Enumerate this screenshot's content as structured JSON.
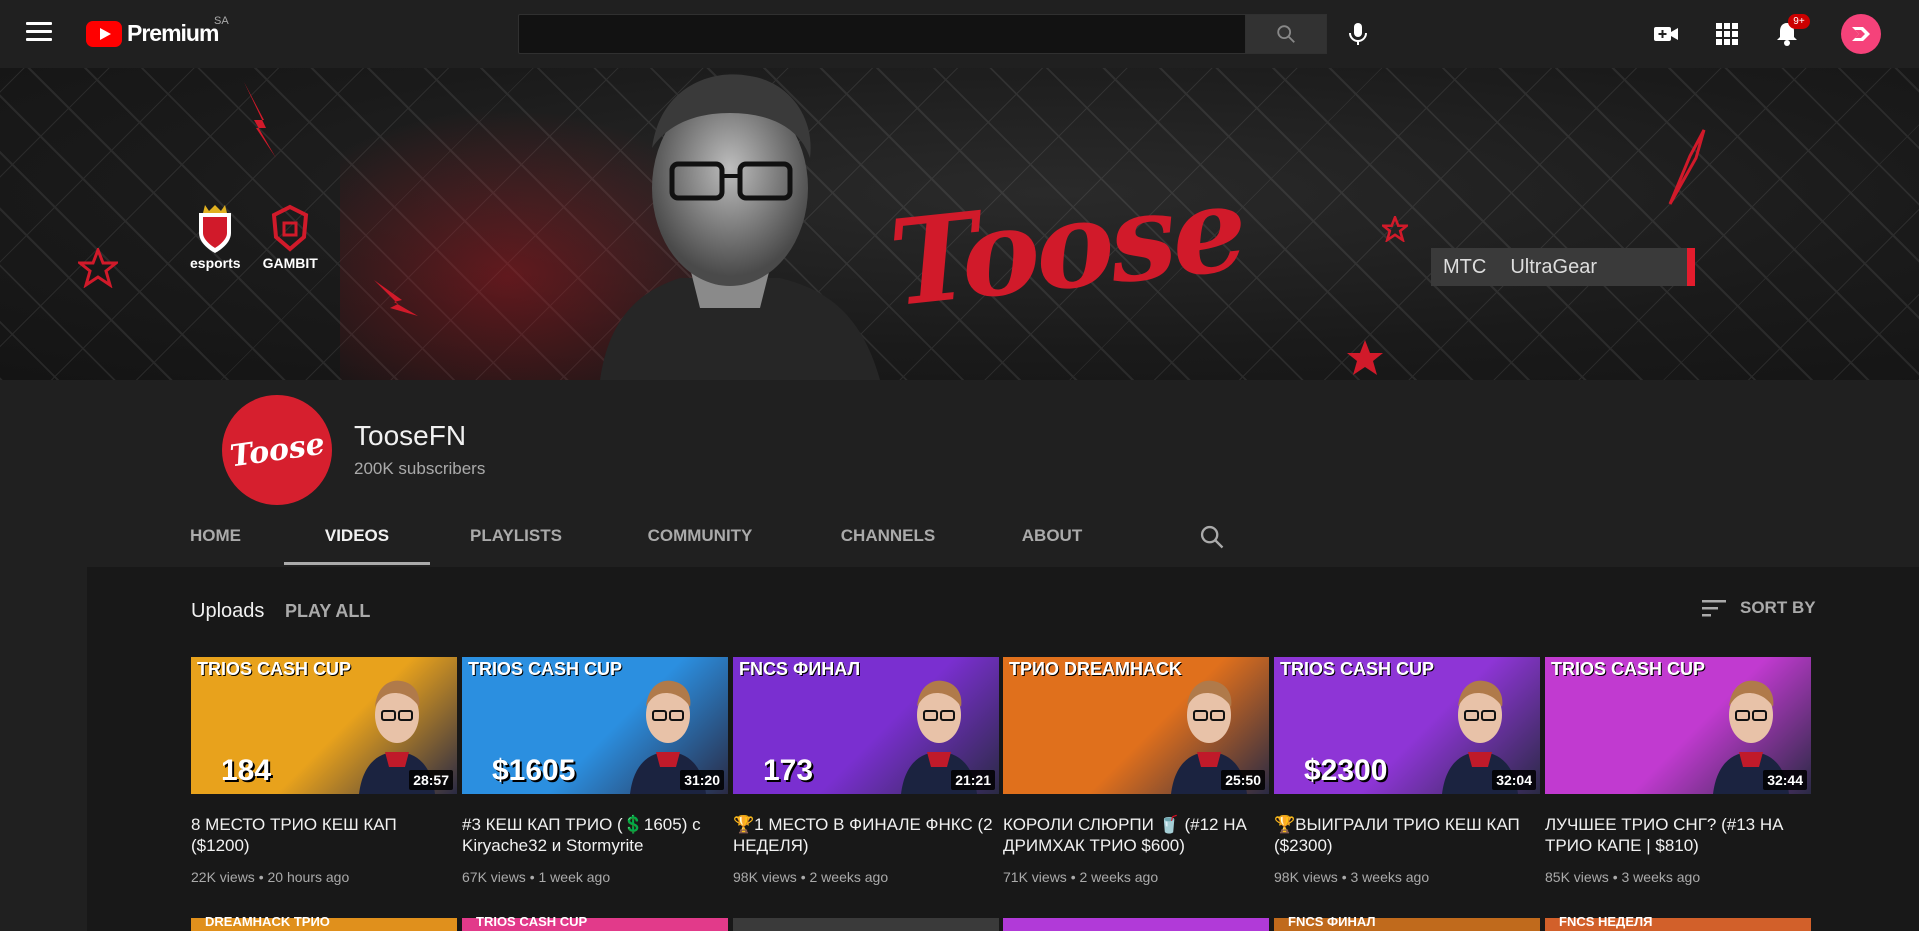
{
  "topbar": {
    "logo_text": "Premium",
    "country_code": "SA",
    "search_value": "",
    "notification_count": "9+"
  },
  "banner": {
    "brand_text": "Toose",
    "team1": "esports",
    "team2": "GAMBIT",
    "sponsor1": "МТС",
    "sponsor2": "UltraGear"
  },
  "channel": {
    "avatar_text": "Toose",
    "name": "TooseFN",
    "subscribers": "200K subscribers"
  },
  "tabs": [
    {
      "label": "HOME"
    },
    {
      "label": "VIDEOS"
    },
    {
      "label": "PLAYLISTS"
    },
    {
      "label": "COMMUNITY"
    },
    {
      "label": "CHANNELS"
    },
    {
      "label": "ABOUT"
    }
  ],
  "section": {
    "title": "Uploads",
    "play_all": "PLAY ALL",
    "sort_by": "SORT BY"
  },
  "videos": [
    {
      "header": "TRIOS CASH CUP",
      "big": "184",
      "duration": "28:57",
      "title": "8 МЕСТО ТРИО КЕШ КАП ($1200)",
      "views": "22K views",
      "age": "20 hours ago",
      "bg": "#e8a21c"
    },
    {
      "header": "TRIOS CASH CUP",
      "big": "$1605",
      "duration": "31:20",
      "title": "#3 КЕШ КАП ТРИО (💲1605) с Kiryache32 и Stormyrite",
      "views": "67K views",
      "age": "1 week ago",
      "bg": "#2b8fe0"
    },
    {
      "header": "FNCS ФИНАЛ",
      "big": "173",
      "duration": "21:21",
      "title": "🏆1 МЕСТО В ФИНАЛЕ ФНКС (2 НЕДЕЛЯ)",
      "views": "98K views",
      "age": "2 weeks ago",
      "bg": "#7a2fd0"
    },
    {
      "header": "ТРИО DREAMHACK",
      "big": "",
      "duration": "25:50",
      "title": "КОРОЛИ СЛЮРПИ 🥤 (#12 НА ДРИМХАК ТРИО $600)",
      "views": "71K views",
      "age": "2 weeks ago",
      "bg": "#e0701c"
    },
    {
      "header": "TRIOS CASH CUP",
      "big": "$2300",
      "duration": "32:04",
      "title": "🏆ВЫИГРАЛИ ТРИО КЕШ КАП ($2300)",
      "views": "98K views",
      "age": "3 weeks ago",
      "bg": "#8e35d6"
    },
    {
      "header": "TRIOS CASH CUP",
      "big": "",
      "duration": "32:44",
      "title": "ЛУЧШЕЕ ТРИО СНГ? (#13 НА ТРИО КАПЕ | $810)",
      "views": "85K views",
      "age": "3 weeks ago",
      "bg": "#c13ad0"
    }
  ],
  "row2_headers": [
    "DREAMHACK ТРИО",
    "TRIOS CASH CUP",
    "",
    "",
    "FNCS ФИНАЛ",
    "FNCS НЕДЕЛЯ"
  ],
  "colors": {
    "accent": "#ff0000",
    "brand_red": "#d11a2a",
    "avatar_pink": "#f5427a"
  }
}
